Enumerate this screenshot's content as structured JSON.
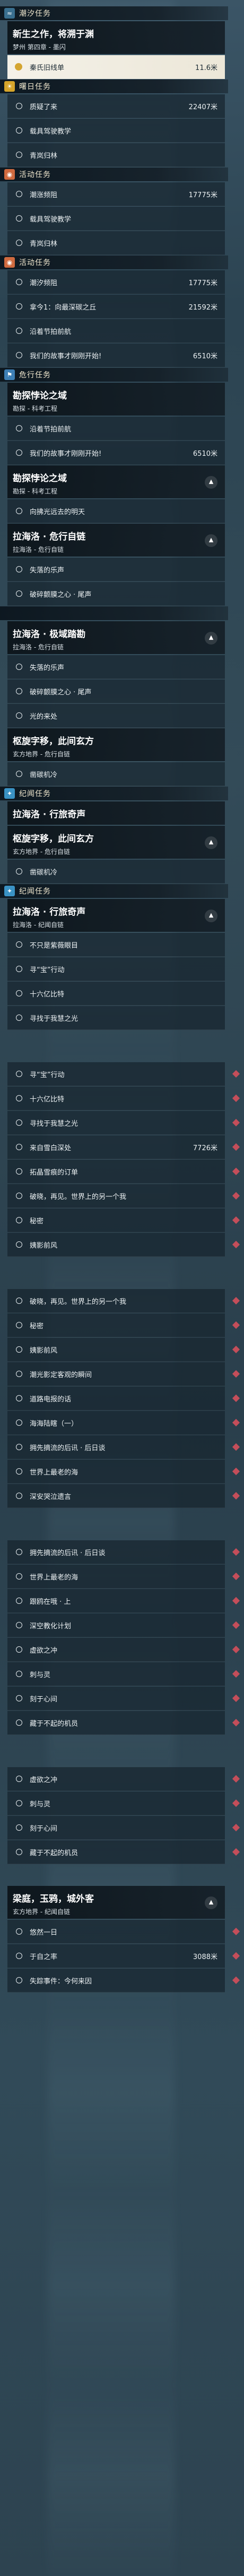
{
  "colors": {
    "dawn": "#d6a52b",
    "legend": "#cf6a3f",
    "danger": "#3d7fb5",
    "anniversary": "#3a92c4",
    "marker": "#c44e5a"
  },
  "items": [
    {
      "kind": "section",
      "label": "潮汐任务",
      "icon": "tide-icon",
      "color": "#3a6f8f",
      "h": 26
    },
    {
      "kind": "title",
      "title": "新生之作，将溯于渊",
      "sub": "梦州  第四章 - 墨闪",
      "h": 62,
      "chev": false
    },
    {
      "kind": "row",
      "text": "秦氏旧线单",
      "dist": "11.6米",
      "hl": true,
      "h": 44
    },
    {
      "kind": "section",
      "label": "曙日任务",
      "icon": "dawn-icon",
      "color": "#d6a52b",
      "h": 26
    },
    {
      "kind": "row",
      "text": "质疑了来",
      "dist": "22407米",
      "h": 44
    },
    {
      "kind": "row",
      "text": "载具驾驶教学",
      "dist": "",
      "h": 44
    },
    {
      "kind": "row",
      "text": "青岚归林",
      "dist": "",
      "h": 44
    },
    {
      "kind": "section",
      "label": "活动任务",
      "icon": "event-icon",
      "color": "#cf6a3f",
      "h": 26
    },
    {
      "kind": "row",
      "text": "潮涨频阻",
      "dist": "17775米",
      "h": 44
    },
    {
      "kind": "row",
      "text": "载具驾驶教学",
      "dist": "",
      "h": 44
    },
    {
      "kind": "row",
      "text": "青岚归林",
      "dist": "",
      "h": 44
    },
    {
      "kind": "section",
      "label": "活动任务",
      "icon": "event-icon",
      "color": "#cf6a3f",
      "h": 26
    },
    {
      "kind": "row",
      "text": "潮汐频阻",
      "dist": "17775米",
      "h": 44
    },
    {
      "kind": "row",
      "text": "拿今1：向最深碳之丘",
      "dist": "21592米",
      "h": 44
    },
    {
      "kind": "row",
      "text": "沿着节拍前航",
      "dist": "",
      "h": 44
    },
    {
      "kind": "row",
      "text": "我们的故事才刚刚开始!",
      "dist": "6510米",
      "h": 44
    },
    {
      "kind": "section",
      "label": "危行任务",
      "icon": "danger-icon",
      "color": "#3d7fb5",
      "h": 26
    },
    {
      "kind": "title",
      "title": "勘探悖论之域",
      "sub": "勘探 - 科考工程",
      "h": 62,
      "chev": false
    },
    {
      "kind": "row",
      "text": "沿着节拍前航",
      "dist": "",
      "h": 44
    },
    {
      "kind": "row",
      "text": "我们的故事才刚刚开始!",
      "dist": "6510米",
      "h": 44
    },
    {
      "kind": "title",
      "title": "勘探悖论之域",
      "sub": "勘探 - 科考工程",
      "h": 62,
      "chev": true
    },
    {
      "kind": "row",
      "text": "向拂光远去的明天",
      "dist": "",
      "h": 44
    },
    {
      "kind": "title",
      "title": "拉海洛 · 危行自链",
      "sub": "拉海洛 - 危行自链",
      "h": 62,
      "chev": true
    },
    {
      "kind": "row",
      "text": "失落的乐声",
      "dist": "",
      "h": 44
    },
    {
      "kind": "row",
      "text": "破碎颤膜之心 · 尾声",
      "dist": "",
      "h": 44
    },
    {
      "kind": "section",
      "label": "",
      "icon": "",
      "color": "#3d7fb5",
      "h": 26
    },
    {
      "kind": "title",
      "title": "拉海洛 · 极域踏勘",
      "sub": "拉海洛 - 危行自链",
      "h": 62,
      "chev": true
    },
    {
      "kind": "row",
      "text": "失落的乐声",
      "dist": "",
      "h": 44
    },
    {
      "kind": "row",
      "text": "破碎颤膜之心 · 尾声",
      "dist": "",
      "h": 44
    },
    {
      "kind": "row",
      "text": "光的来处",
      "dist": "",
      "h": 44
    },
    {
      "kind": "title",
      "title": "枢旋字移，此间玄方",
      "sub": "玄方地界 - 危行自链",
      "h": 62,
      "chev": false
    },
    {
      "kind": "row",
      "text": "凿碳机冷",
      "dist": "",
      "h": 44
    },
    {
      "kind": "section",
      "label": "纪闻任务",
      "icon": "anniversary-icon",
      "color": "#3a92c4",
      "h": 26
    },
    {
      "kind": "title",
      "title": "拉海洛 · 行旅奇声",
      "sub": "",
      "h": 44,
      "chev": false
    },
    {
      "kind": "title",
      "title": "枢旋字移，此间玄方",
      "sub": "玄方地界 - 危行自链",
      "h": 62,
      "chev": true
    },
    {
      "kind": "row",
      "text": "凿碳机冷",
      "dist": "",
      "h": 44
    },
    {
      "kind": "section",
      "label": "纪闻任务",
      "icon": "anniversary-icon",
      "color": "#3a92c4",
      "h": 26
    },
    {
      "kind": "title",
      "title": "拉海洛 · 行旅奇声",
      "sub": "拉海洛 - 纪闻自链",
      "h": 62,
      "chev": true
    },
    {
      "kind": "row",
      "text": "不只是紫薇眼目",
      "dist": "",
      "h": 44
    },
    {
      "kind": "row",
      "text": "寻“宝”行动",
      "dist": "",
      "h": 44
    },
    {
      "kind": "row",
      "text": "十六亿比特",
      "dist": "",
      "h": 44
    },
    {
      "kind": "row",
      "text": "寻找于我慧之光",
      "dist": "",
      "h": 44
    },
    {
      "kind": "gap",
      "h": 60
    },
    {
      "kind": "row",
      "text": "寻“宝”行动",
      "dist": "",
      "h": 44
    },
    {
      "kind": "row",
      "text": "十六亿比特",
      "dist": "",
      "h": 44
    },
    {
      "kind": "row",
      "text": "寻找于我慧之光",
      "dist": "",
      "h": 44
    },
    {
      "kind": "row",
      "text": "来自雪白深处",
      "dist": "7726米",
      "h": 44
    },
    {
      "kind": "row",
      "text": "拓晶雪痕的订单",
      "dist": "",
      "h": 44
    },
    {
      "kind": "row",
      "text": "破晓，再见。世界上的另一个我",
      "dist": "",
      "h": 44
    },
    {
      "kind": "row",
      "text": "秘密",
      "dist": "",
      "h": 44
    },
    {
      "kind": "row",
      "text": "姨影前风",
      "dist": "",
      "h": 44
    },
    {
      "kind": "gap",
      "h": 60
    },
    {
      "kind": "row",
      "text": "破晓，再见。世界上的另一个我",
      "dist": "",
      "h": 44
    },
    {
      "kind": "row",
      "text": "秘密",
      "dist": "",
      "h": 44
    },
    {
      "kind": "row",
      "text": "姨影前风",
      "dist": "",
      "h": 44
    },
    {
      "kind": "row",
      "text": "潮光影定客观的瞬间",
      "dist": "",
      "h": 44
    },
    {
      "kind": "row",
      "text": "道路电报的话",
      "dist": "",
      "h": 44
    },
    {
      "kind": "row",
      "text": "海海陆瞎（一）",
      "dist": "",
      "h": 44
    },
    {
      "kind": "row",
      "text": "拥先摘流的后讯 · 后日谈",
      "dist": "",
      "h": 44
    },
    {
      "kind": "row",
      "text": "世界上最老的海",
      "dist": "",
      "h": 44
    },
    {
      "kind": "row",
      "text": "深安哭泣遗言",
      "dist": "",
      "h": 44
    },
    {
      "kind": "gap",
      "h": 60
    },
    {
      "kind": "row",
      "text": "拥先摘流的后讯 · 后日谈",
      "dist": "",
      "h": 44
    },
    {
      "kind": "row",
      "text": "世界上最老的海",
      "dist": "",
      "h": 44
    },
    {
      "kind": "row",
      "text": "跟鸥在哦 · 上",
      "dist": "",
      "h": 44
    },
    {
      "kind": "row",
      "text": "深空教化计划",
      "dist": "",
      "h": 44
    },
    {
      "kind": "row",
      "text": "虚欲之冲",
      "dist": "",
      "h": 44
    },
    {
      "kind": "row",
      "text": "刺与灵",
      "dist": "",
      "h": 44
    },
    {
      "kind": "row",
      "text": "刻于心间",
      "dist": "",
      "h": 44
    },
    {
      "kind": "row",
      "text": "藏于不起的机员",
      "dist": "",
      "h": 44
    },
    {
      "kind": "gap",
      "h": 60
    },
    {
      "kind": "row",
      "text": "虚欲之冲",
      "dist": "",
      "h": 44
    },
    {
      "kind": "row",
      "text": "刺与灵",
      "dist": "",
      "h": 44
    },
    {
      "kind": "row",
      "text": "刻于心间",
      "dist": "",
      "h": 44
    },
    {
      "kind": "row",
      "text": "藏于不起的机员",
      "dist": "",
      "h": 44
    },
    {
      "kind": "gap",
      "h": 40
    },
    {
      "kind": "title",
      "title": "梁庭，玉鸦，城外客",
      "sub": "玄方地界 - 纪闻自链",
      "h": 62,
      "chev": true
    },
    {
      "kind": "row",
      "text": "悠然一日",
      "dist": "",
      "h": 44
    },
    {
      "kind": "row",
      "text": "于自之率",
      "dist": "3088米",
      "h": 44
    },
    {
      "kind": "row",
      "text": "失踪事件：今何来因",
      "dist": "",
      "h": 44
    }
  ]
}
